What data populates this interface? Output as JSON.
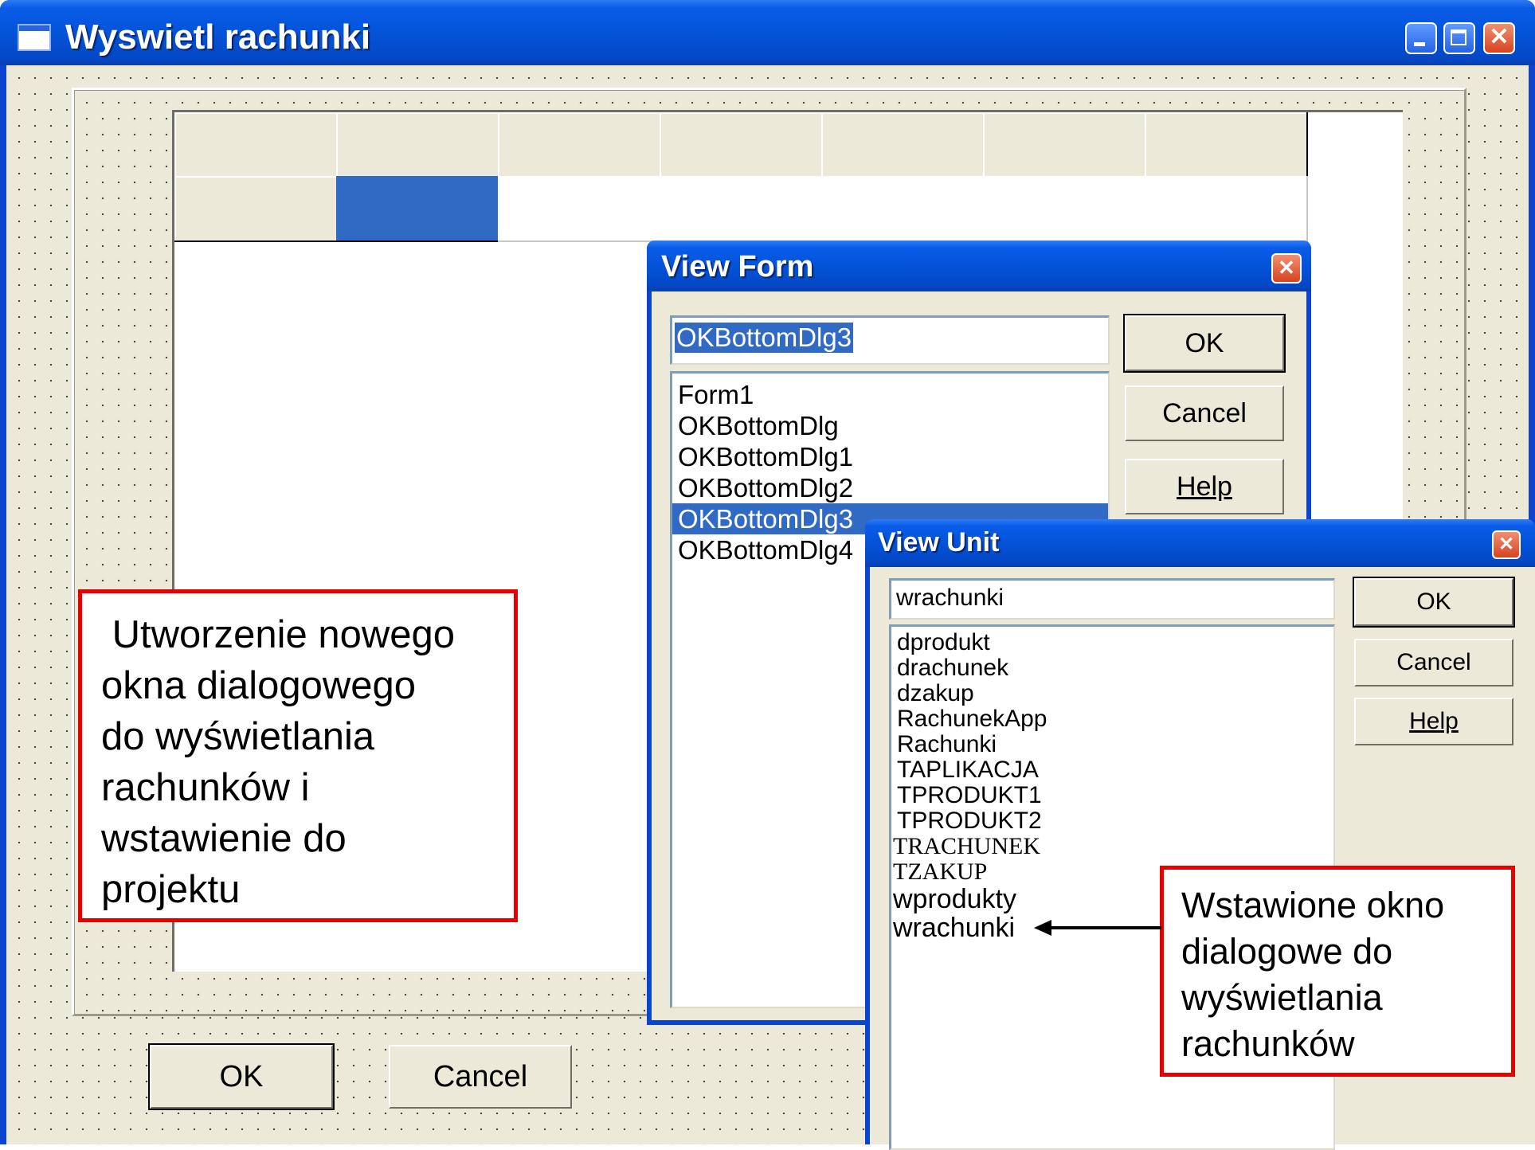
{
  "main_window": {
    "title": "Wyswietl rachunki",
    "close_glyph": "✕",
    "ok_label": "OK",
    "cancel_label": "Cancel"
  },
  "view_form": {
    "title": "View Form",
    "close_glyph": "✕",
    "input_value": "OKBottomDlg3",
    "items": [
      "Form1",
      "OKBottomDlg",
      "OKBottomDlg1",
      "OKBottomDlg2",
      "OKBottomDlg3",
      "OKBottomDlg4"
    ],
    "selected_item": "OKBottomDlg3",
    "ok_label": "OK",
    "cancel_label": "Cancel",
    "help_label": "Help"
  },
  "view_unit": {
    "title": "View Unit",
    "close_glyph": "✕",
    "input_value": "wrachunki",
    "items": [
      "dprodukt",
      "drachunek",
      "dzakup",
      "RachunekApp",
      "Rachunki",
      "TAPLIKACJA",
      "TPRODUKT1",
      "TPRODUKT2",
      "TRACHUNEK",
      "TZAKUP",
      "wprodukty",
      "wrachunki"
    ],
    "ok_label": "OK",
    "cancel_label": "Cancel",
    "help_label": "Help"
  },
  "callouts": {
    "left_lines": [
      " Utworzenie nowego",
      "okna dialogowego",
      "do wyświetlania",
      "rachunków i",
      "wstawienie do",
      "projektu"
    ],
    "right_lines": [
      "Wstawione okno",
      "dialogowe do",
      "wyświetlania",
      "rachunków"
    ]
  },
  "colors": {
    "xp_title_blue": "#0453d9",
    "selection_blue": "#316ac5",
    "window_face": "#ece9d8",
    "callout_red": "#e60000",
    "close_red": "#d8431f"
  },
  "icons": [
    "window-app-icon",
    "minimize-icon",
    "maximize-icon",
    "close-icon",
    "arrow-left-icon"
  ]
}
